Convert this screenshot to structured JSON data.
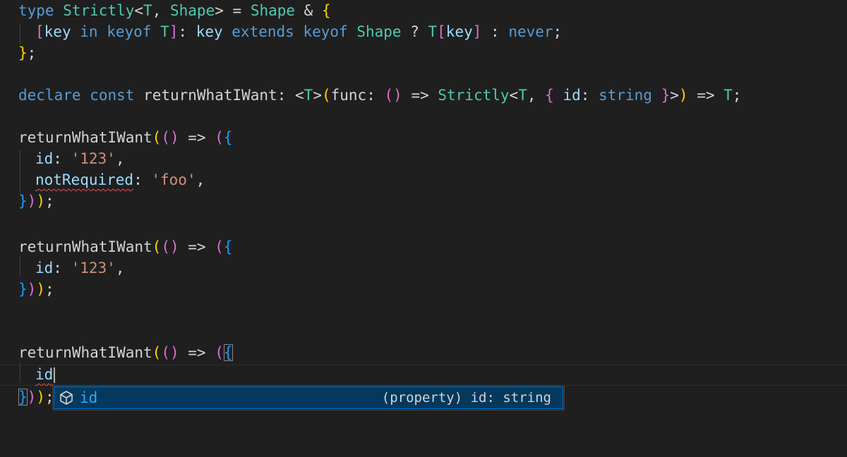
{
  "editor": {
    "lines": {
      "l1": [
        "type",
        " ",
        "Strictly",
        "<",
        "T",
        ", ",
        "Shape",
        ">",
        " = ",
        "Shape",
        " & ",
        "{"
      ],
      "l2": [
        "[",
        "key",
        " ",
        "in",
        " ",
        "keyof",
        " ",
        "T",
        "]",
        ": ",
        "key",
        " ",
        "extends",
        " ",
        "keyof",
        " ",
        "Shape",
        " ? ",
        "T",
        "[",
        "key",
        "]",
        " : ",
        "never",
        ";"
      ],
      "l3": [
        "}",
        ";"
      ],
      "l5": [
        "declare",
        " ",
        "const",
        " ",
        "returnWhatIWant",
        ": ",
        "<",
        "T",
        ">",
        "(",
        "func",
        ": ",
        "(",
        ")",
        " => ",
        "Strictly",
        "<",
        "T",
        ", ",
        "{",
        " ",
        "id",
        ": ",
        "string",
        " ",
        "}",
        ">",
        ")",
        " => ",
        "T",
        ";"
      ],
      "l7": [
        "returnWhatIWant",
        "(",
        "(",
        ")",
        " => ",
        "(",
        "{"
      ],
      "l8": [
        "id",
        ": ",
        "'123'",
        ","
      ],
      "l9": [
        "notRequired",
        ": ",
        "'foo'",
        ","
      ],
      "l10": [
        "}",
        ")",
        ")",
        ";"
      ],
      "l12": [
        "returnWhatIWant",
        "(",
        "(",
        ")",
        " => ",
        "(",
        "{"
      ],
      "l13": [
        "id",
        ": ",
        "'123'",
        ","
      ],
      "l14": [
        "}",
        ")",
        ")",
        ";"
      ],
      "l17": [
        "returnWhatIWant",
        "(",
        "(",
        ")",
        " => ",
        "(",
        "{"
      ],
      "l18": [
        "id"
      ],
      "l19": [
        "}",
        ")",
        ")",
        ";"
      ]
    }
  },
  "suggest": {
    "icon": "property-icon",
    "label": "id",
    "detail": "(property) id: string"
  },
  "colors": {
    "background": "#1f1f1f",
    "keyword": "#569cd6",
    "type": "#4ec9b0",
    "function": "#dcdcaa",
    "variable": "#9cdcfe",
    "string": "#ce9178",
    "error": "#f14c4c",
    "suggest_selected": "#04395e",
    "suggest_label": "#2aaaff"
  }
}
